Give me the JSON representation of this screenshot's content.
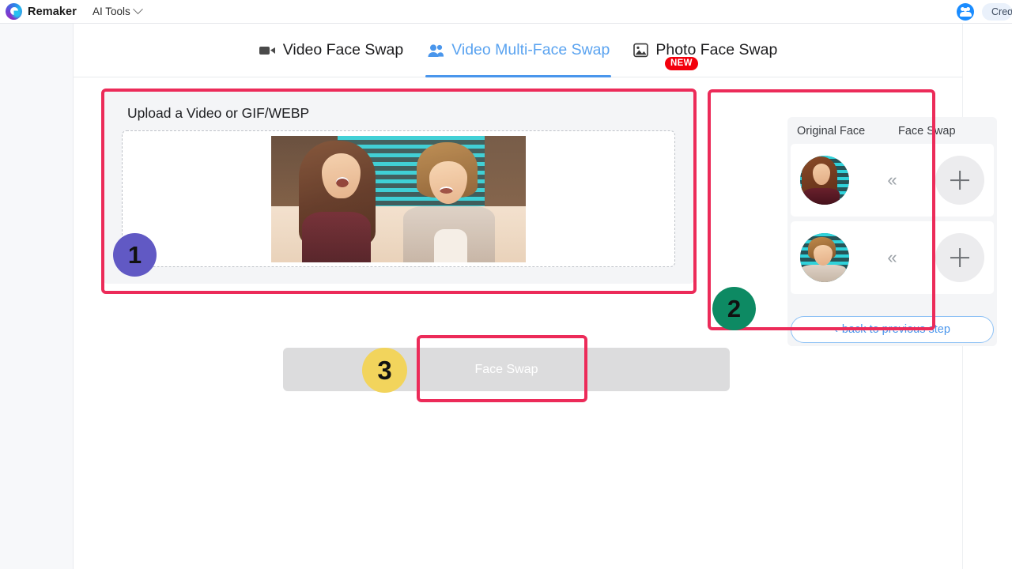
{
  "app": {
    "brand": "Remaker",
    "logo_icon": "remaker-swirl-logo",
    "nav_menu": "AI Tools",
    "chevron_icon": "chevron-down-icon"
  },
  "header_right": {
    "people_icon": "people-group-icon",
    "credits_label": "Cred"
  },
  "tabs": [
    {
      "label": "Video Face Swap",
      "icon": "video-camera-icon",
      "active": false
    },
    {
      "label": "Video Multi-Face Swap",
      "icon": "multi-user-icon",
      "active": true
    },
    {
      "label": "Photo Face Swap",
      "icon": "photo-image-icon",
      "active": false
    }
  ],
  "new_badge": "NEW",
  "upload": {
    "title": "Upload a Video or GIF/WEBP",
    "dropzone_name": "video-dropzone",
    "preview_alt": "uploaded video still of two people laughing on a talk-show couch"
  },
  "faces": {
    "col_original": "Original Face",
    "col_swap": "Face Swap",
    "rows": [
      {
        "thumb": "detected-face-1",
        "arrow": "«",
        "add_icon": "plus-icon"
      },
      {
        "thumb": "detected-face-2",
        "arrow": "«",
        "add_icon": "plus-icon"
      }
    ],
    "back_button": "back to previous step",
    "back_arrow": "‹"
  },
  "action": {
    "face_swap_label": "Face Swap",
    "disabled": true
  },
  "annotations": {
    "step1": "1",
    "step2": "2",
    "step3": "3",
    "box_color": "#ec2b59",
    "step1_color": "#6159c4",
    "step2_color": "#0d8a63",
    "step3_color": "#f2d45c"
  }
}
